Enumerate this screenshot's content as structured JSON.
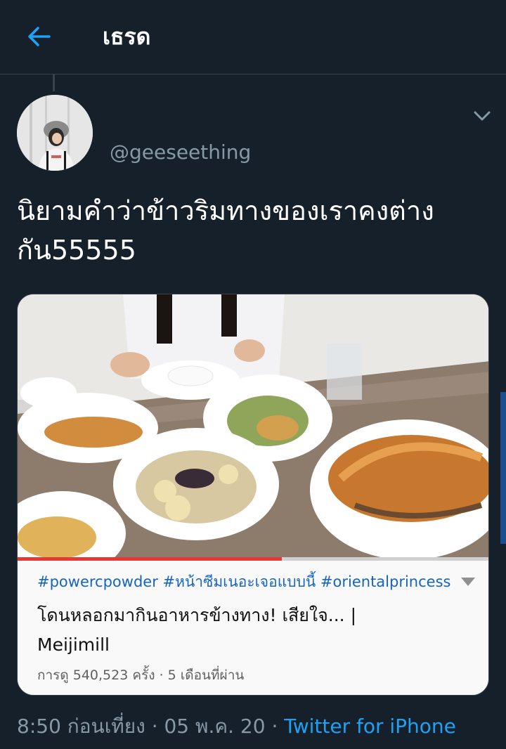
{
  "header": {
    "title": "เธรด",
    "back_icon": "arrow-left-icon",
    "accent": "#1da1f2"
  },
  "tweet": {
    "display_name": "",
    "handle": "@geeseething",
    "text_line1": "นิยามคำว่าข้าวริมทางของเราคงต่าง",
    "text_line2": "กัน55555",
    "meta": {
      "time": "8:50 ก่อนเที่ยง · 05 พ.ค. 20 · ",
      "source": "Twitter for iPhone"
    }
  },
  "card": {
    "hashtags": "#powercpowder #หน้าซีมเนอะเจอแบบนี้ #orientalprincess",
    "title_line1": "โดนหลอกมากินอาหารข้างทาง! เสียใจ... |",
    "title_line2": "Meijimill",
    "stats": "การดู 540,523 ครั้ง · 5 เดือนที่ผ่าน",
    "progress": 0.56,
    "progress_color": "#e53935"
  },
  "colors": {
    "background": "#15202b",
    "text": "#ffffff",
    "secondary": "#8899a6",
    "link": "#1da1f2",
    "divider": "#38444d"
  }
}
